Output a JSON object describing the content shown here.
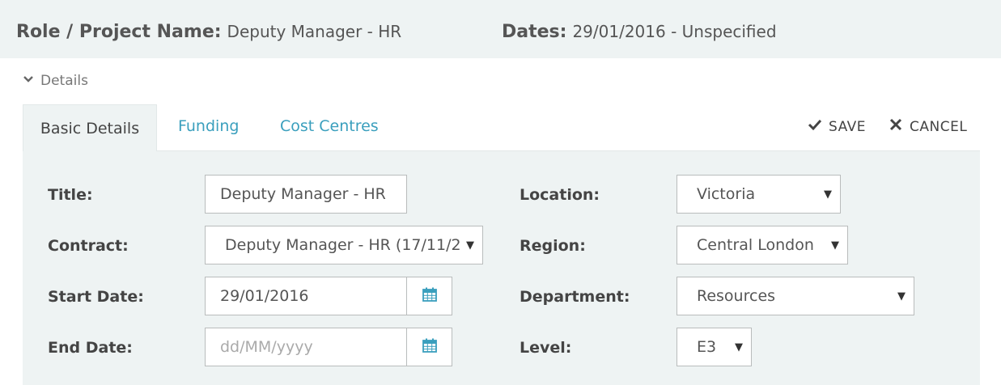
{
  "header": {
    "role_label": "Role / Project Name:",
    "role_value": "Deputy Manager - HR",
    "dates_label": "Dates:",
    "dates_value": "29/01/2016 - Unspecified"
  },
  "details_toggle": {
    "label": "Details"
  },
  "tabs": [
    {
      "label": "Basic Details",
      "active": true
    },
    {
      "label": "Funding",
      "active": false
    },
    {
      "label": "Cost Centres",
      "active": false
    }
  ],
  "actions": {
    "save_label": "SAVE",
    "cancel_label": "CANCEL"
  },
  "form": {
    "title": {
      "label": "Title:",
      "value": "Deputy Manager - HR"
    },
    "contract": {
      "label": "Contract:",
      "value": "Deputy Manager - HR (17/11/2"
    },
    "start_date": {
      "label": "Start Date:",
      "value": "29/01/2016"
    },
    "end_date": {
      "label": "End Date:",
      "placeholder": "dd/MM/yyyy"
    },
    "location": {
      "label": "Location:",
      "value": "Victoria"
    },
    "region": {
      "label": "Region:",
      "value": "Central London"
    },
    "department": {
      "label": "Department:",
      "value": "Resources"
    },
    "level": {
      "label": "Level:",
      "value": "E3"
    }
  },
  "colors": {
    "accent": "#3a9fbd",
    "panel_bg": "#eef3f3",
    "calendar_icon": "#3a9fbd"
  },
  "icons": [
    "chevron-down-icon",
    "check-icon",
    "close-icon",
    "calendar-icon",
    "caret-down-icon"
  ]
}
